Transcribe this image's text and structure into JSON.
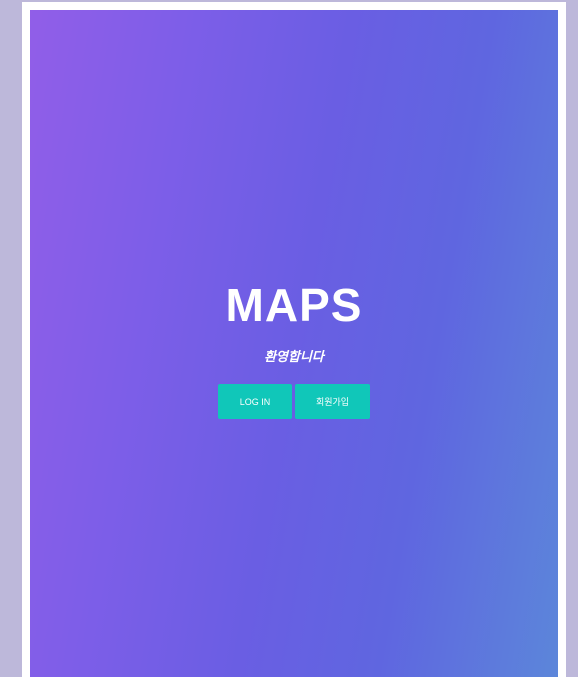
{
  "app": {
    "title": "MAPS",
    "welcome": "환영합니다"
  },
  "buttons": {
    "login_label": "LOG IN",
    "signup_label": "회원가입"
  },
  "colors": {
    "page_background": "#bdb8da",
    "gradient_start": "#915ee8",
    "gradient_end": "#5c86da",
    "button": "#10c7b9",
    "text": "#ffffff"
  }
}
